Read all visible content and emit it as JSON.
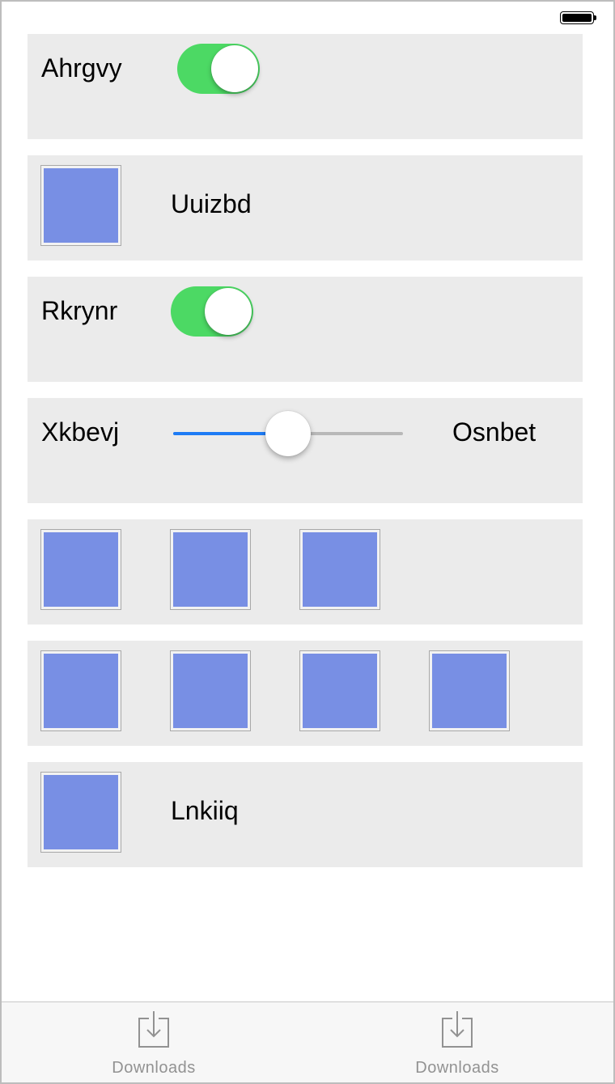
{
  "status_bar": {
    "battery_icon": "battery-full-icon",
    "battery_level": 1.0
  },
  "rows": {
    "row1": {
      "label": "Ahrgvy",
      "toggle_on": true
    },
    "row2": {
      "label": "Uuizbd",
      "image_icon": "image-placeholder-icon"
    },
    "row3": {
      "label": "Rkrynr",
      "toggle_on": true
    },
    "row4": {
      "left_label": "Xkbevj",
      "right_label": "Osnbet",
      "slider_value": 0.5
    },
    "row5": {
      "image_count": 3
    },
    "row6": {
      "image_count": 4
    },
    "row7": {
      "label": "Lnkiiq",
      "image_icon": "image-placeholder-icon"
    }
  },
  "tabbar": {
    "tabs": [
      {
        "label": "Downloads",
        "icon": "download-tray-icon"
      },
      {
        "label": "Downloads",
        "icon": "download-tray-icon"
      }
    ]
  },
  "colors": {
    "toggle_on": "#4cd964",
    "slider_min_track": "#1d7bf5",
    "image_fill": "#788fe4",
    "row_background": "#ebebeb"
  }
}
